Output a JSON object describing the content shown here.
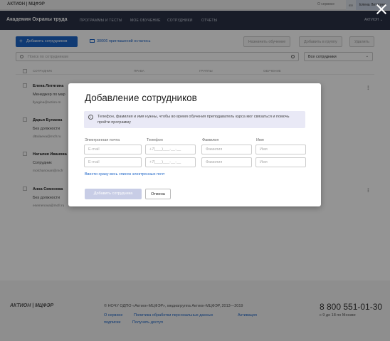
{
  "topbar": {
    "logo": "АКТИОН | МЦФЭР",
    "links": [
      "О сервисе",
      "Помощь",
      "Выход"
    ],
    "avatar_label": "ЕЛ",
    "user": "Елена Литягина"
  },
  "nav": {
    "title": "Академия Охраны труда",
    "items": [
      "ПРОГРАММЫ И ТЕСТЫ",
      "МОЕ ОБУЧЕНИЕ",
      "СОТРУДНИКИ",
      "ОТЧЕТЫ"
    ],
    "right": "АКТИОН"
  },
  "toolbar": {
    "add_label": "Добавить сотрудников",
    "invites_label": "30006 приглашений осталось",
    "assign_label": "Назначить обучение",
    "group_label": "Добавить в группу",
    "delete_label": "Удалить"
  },
  "search": {
    "placeholder": "Поиск по сотрудникам"
  },
  "filter": {
    "value": "Все сотрудники"
  },
  "table": {
    "headers": [
      "СОТРУДНИК",
      "ПРАВА",
      "ГРУППЫ",
      "ОБУЧЕНИЕ"
    ],
    "rows": [
      {
        "name": "Елена Литягина",
        "role": "Менеджер по мар",
        "email": "llyagina@action-m"
      },
      {
        "name": "Дарья Булаева",
        "role": "Без должности",
        "email": "dBulaeva@mcfr.ru"
      },
      {
        "name": "Наталия Иванова",
        "role": "Сотрудник",
        "email": "molchanovan@mcfr"
      },
      {
        "name": "Анна Семенова",
        "role": "Без должности",
        "email": "esemenova@mcfr.ru"
      }
    ]
  },
  "footer": {
    "logo": "АКТИОН | МЦФЭР",
    "copyright": "© НОЧУ ОДПО «Актион-МЦФЭР», медиагруппа Актион-МЦФЭР, 2013—2019",
    "links": [
      "О сервисе",
      "Политика обработки персональных данных",
      "Активация",
      "подписки",
      "Получить доступ"
    ],
    "phone": "8 800 551-01-30",
    "hours": "с 9 до 18 по Москве"
  },
  "modal": {
    "title": "Добавление сотрудников",
    "info": "Телефон, фамилия и имя нужны, чтобы во время обучения преподаватель курса мог связаться и помочь пройти программу",
    "labels": {
      "email": "Электронная почта",
      "phone": "Телефон",
      "lastname": "Фамилия",
      "firstname": "Имя"
    },
    "placeholders": {
      "email": "E-mail",
      "phone": "+7(___)___-__-__",
      "lastname": "Фамилия",
      "firstname": "Имя"
    },
    "bulk_link": "Ввести сразу весь список электронных почт",
    "submit_label": "Добавить сотрудника",
    "cancel_label": "Отмена"
  },
  "colors": {
    "accent": "#1c64c7",
    "navbar": "#2a3146",
    "info_bg": "#e9e9f6",
    "disabled_button": "#c8cde6"
  }
}
